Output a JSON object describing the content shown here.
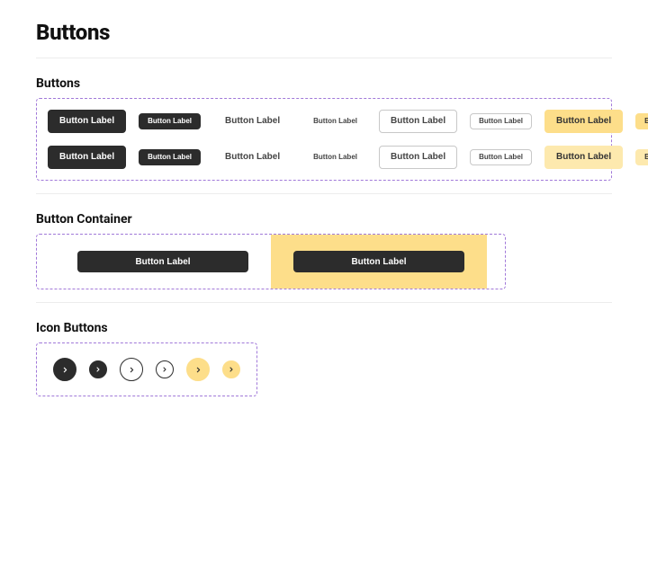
{
  "page_title": "Buttons",
  "sections": {
    "buttons": {
      "heading": "Buttons",
      "button_label": "Button Label"
    },
    "container": {
      "heading": "Button Container",
      "button_label": "Button Label"
    },
    "icon_buttons": {
      "heading": "Icon Buttons",
      "icon": "chevron-right"
    }
  },
  "colors": {
    "ink": "#2c2c2c",
    "yellow": "#fdde8a",
    "dash": "#a179d9"
  }
}
